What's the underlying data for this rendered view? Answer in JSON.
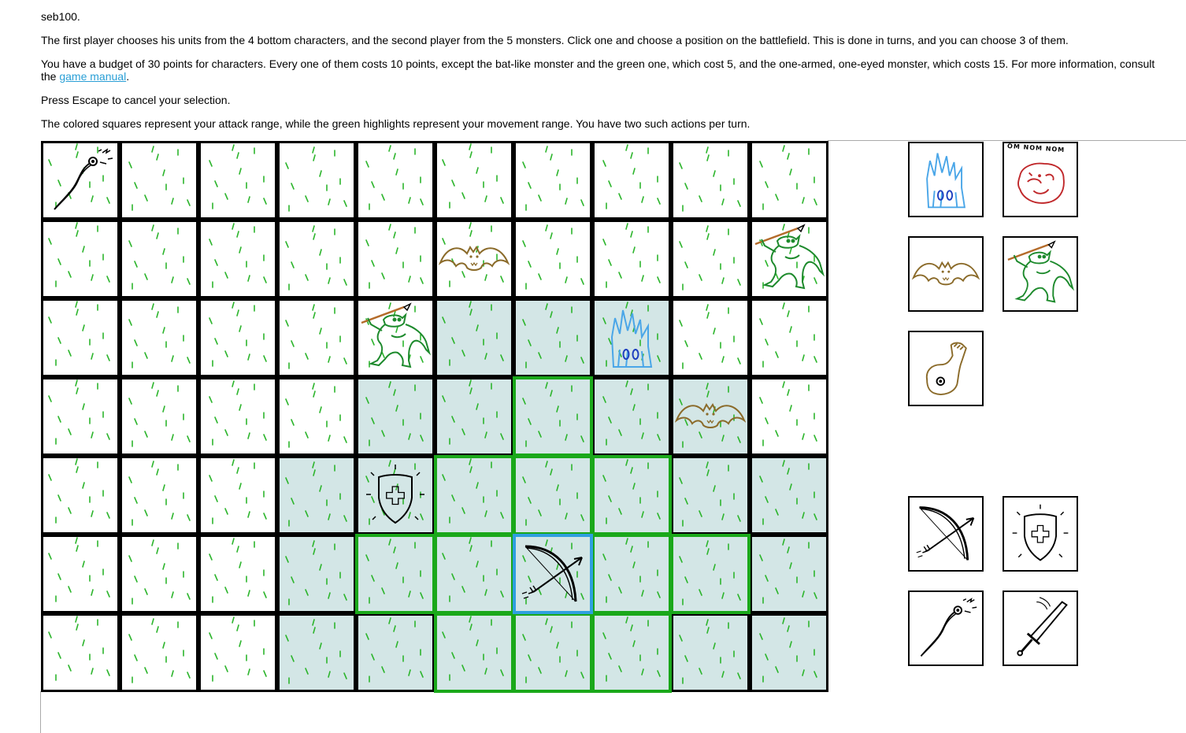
{
  "header": {
    "username": "seb100.",
    "rules_text": "The first player chooses his units from the 4 bottom characters, and the second player from the 5 monsters. Click one and choose a position on the battlefield. This is done in turns, and you can choose 3 of them.",
    "budget_text": "You have a budget of 30 points for characters. Every one of them costs 10 points, except the bat-like monster and the green one, which cost 5, and the one-armed, one-eyed monster, which costs 15. For more information, consult the ",
    "manual_link": "game manual",
    "budget_end": ".",
    "escape_text": "Press Escape to cancel your selection.",
    "range_text": "The colored squares represent your attack range, while the green highlights represent your movement range. You have two such actions per turn."
  },
  "board": {
    "cols": 10,
    "rows": 7,
    "attack_cells": [
      [
        2,
        5
      ],
      [
        2,
        6
      ],
      [
        2,
        7
      ],
      [
        3,
        4
      ],
      [
        3,
        5
      ],
      [
        3,
        6
      ],
      [
        3,
        7
      ],
      [
        3,
        8
      ],
      [
        4,
        3
      ],
      [
        4,
        4
      ],
      [
        4,
        5
      ],
      [
        4,
        6
      ],
      [
        4,
        7
      ],
      [
        4,
        8
      ],
      [
        4,
        9
      ],
      [
        5,
        3
      ],
      [
        5,
        4
      ],
      [
        5,
        5
      ],
      [
        5,
        6
      ],
      [
        5,
        7
      ],
      [
        5,
        8
      ],
      [
        5,
        9
      ],
      [
        6,
        3
      ],
      [
        6,
        4
      ],
      [
        6,
        5
      ],
      [
        6,
        6
      ],
      [
        6,
        7
      ],
      [
        6,
        8
      ],
      [
        6,
        9
      ]
    ],
    "move_cells": [
      [
        3,
        6
      ],
      [
        4,
        5
      ],
      [
        4,
        6
      ],
      [
        4,
        7
      ],
      [
        5,
        4
      ],
      [
        5,
        5
      ],
      [
        5,
        7
      ],
      [
        5,
        8
      ],
      [
        6,
        5
      ],
      [
        6,
        6
      ],
      [
        6,
        7
      ]
    ],
    "selected_cell": [
      5,
      6
    ],
    "units": [
      {
        "row": 0,
        "col": 0,
        "type": "whip-icon"
      },
      {
        "row": 1,
        "col": 5,
        "type": "bat-monster-icon"
      },
      {
        "row": 1,
        "col": 9,
        "type": "goblin-spear-icon"
      },
      {
        "row": 2,
        "col": 4,
        "type": "goblin-spear-icon"
      },
      {
        "row": 2,
        "col": 7,
        "type": "ice-crystal-monster-icon"
      },
      {
        "row": 3,
        "col": 8,
        "type": "bat-monster-icon"
      },
      {
        "row": 4,
        "col": 4,
        "type": "shield-icon"
      },
      {
        "row": 5,
        "col": 6,
        "type": "bow-icon"
      }
    ]
  },
  "monster_palette": [
    {
      "type": "ice-crystal-monster-icon"
    },
    {
      "type": "blob-monster-icon",
      "caption": "OM NOM NOM"
    },
    {
      "type": "bat-monster-icon"
    },
    {
      "type": "goblin-spear-icon"
    },
    {
      "type": "one-eyed-monster-icon"
    }
  ],
  "character_palette": [
    {
      "type": "bow-icon"
    },
    {
      "type": "shield-icon"
    },
    {
      "type": "whip-icon"
    },
    {
      "type": "sword-icon"
    }
  ],
  "colors": {
    "attack_fill": "#d3e6e6",
    "move_highlight": "#1aa81a",
    "selected_highlight": "#2f9fe0",
    "grass": "#2db52d",
    "link": "#2a9fd6"
  }
}
